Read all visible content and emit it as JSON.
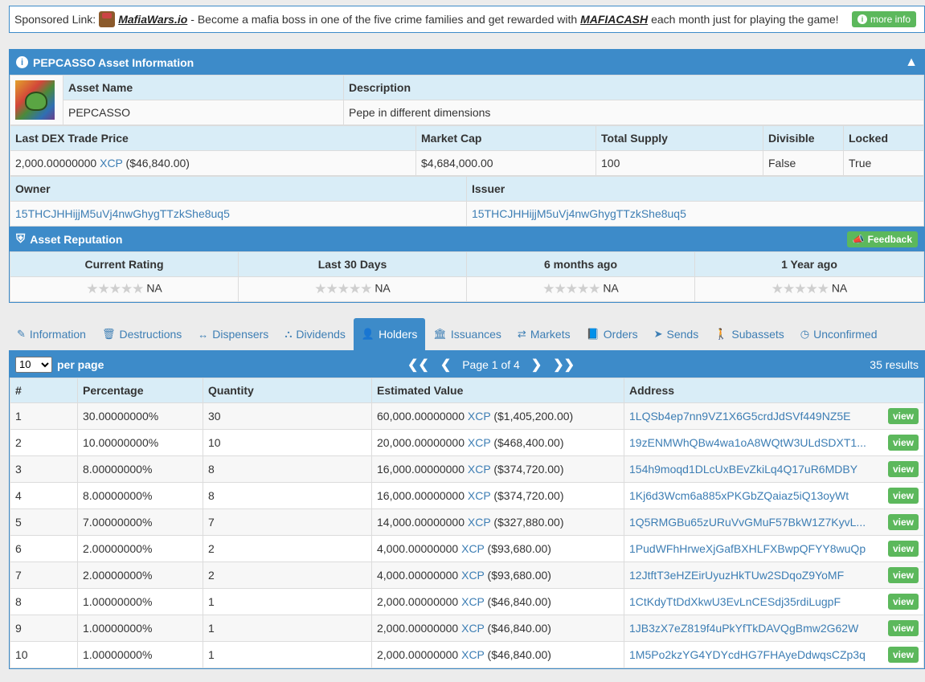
{
  "sponsor": {
    "prefix": "Sponsored Link:",
    "site": "MafiaWars.io",
    "text1": "- Become a mafia boss in one of the five crime families and get rewarded with",
    "cash": "MAFIACASH",
    "text2": "each month just for playing the game!",
    "more_info": "more info"
  },
  "asset_panel": {
    "title": "PEPCASSO Asset Information",
    "asset_name_label": "Asset Name",
    "description_label": "Description",
    "asset_name": "PEPCASSO",
    "description": "Pepe in different dimensions",
    "last_trade_label": "Last DEX Trade Price",
    "market_cap_label": "Market Cap",
    "total_supply_label": "Total Supply",
    "divisible_label": "Divisible",
    "locked_label": "Locked",
    "last_trade_amount": "2,000.00000000",
    "last_trade_unit": "XCP",
    "last_trade_usd": "($46,840.00)",
    "market_cap": "$4,684,000.00",
    "total_supply": "100",
    "divisible": "False",
    "locked": "True",
    "owner_label": "Owner",
    "issuer_label": "Issuer",
    "owner": "15THCJHHijjM5uVj4nwGhygTTzkShe8uq5",
    "issuer": "15THCJHHijjM5uVj4nwGhygTTzkShe8uq5"
  },
  "reputation": {
    "title": "Asset Reputation",
    "feedback": "Feedback",
    "columns": [
      "Current Rating",
      "Last 30 Days",
      "6 months ago",
      "1 Year ago"
    ],
    "values": [
      "NA",
      "NA",
      "NA",
      "NA"
    ]
  },
  "tabs": [
    {
      "label": "Information",
      "icon": "tag-icon",
      "glyph": "✎"
    },
    {
      "label": "Destructions",
      "icon": "trash-icon",
      "glyph": "🗑"
    },
    {
      "label": "Dispensers",
      "icon": "arrows-h-icon",
      "glyph": "↔"
    },
    {
      "label": "Dividends",
      "icon": "sitemap-icon",
      "glyph": "⛬"
    },
    {
      "label": "Holders",
      "icon": "user-icon",
      "glyph": "👤"
    },
    {
      "label": "Issuances",
      "icon": "bank-icon",
      "glyph": "🏛"
    },
    {
      "label": "Markets",
      "icon": "exchange-icon",
      "glyph": "⇄"
    },
    {
      "label": "Orders",
      "icon": "book-icon",
      "glyph": "📘"
    },
    {
      "label": "Sends",
      "icon": "send-icon",
      "glyph": "➤"
    },
    {
      "label": "Subassets",
      "icon": "child-icon",
      "glyph": "🚶"
    },
    {
      "label": "Unconfirmed",
      "icon": "clock-icon",
      "glyph": "◷"
    }
  ],
  "holders": {
    "per_page_value": "10",
    "per_page_label": "per page",
    "page_text": "Page 1 of 4",
    "results": "35 results",
    "columns": [
      "#",
      "Percentage",
      "Quantity",
      "Estimated Value",
      "Address"
    ],
    "view_label": "view",
    "rows": [
      {
        "n": "1",
        "pct": "30.00000000%",
        "qty": "30",
        "amt": "60,000.00000000",
        "unit": "XCP",
        "usd": "($1,405,200.00)",
        "addr": "1LQSb4ep7nn9VZ1X6G5crdJdSVf449NZ5E"
      },
      {
        "n": "2",
        "pct": "10.00000000%",
        "qty": "10",
        "amt": "20,000.00000000",
        "unit": "XCP",
        "usd": "($468,400.00)",
        "addr": "19zENMWhQBw4wa1oA8WQtW3ULdSDXT1..."
      },
      {
        "n": "3",
        "pct": "8.00000000%",
        "qty": "8",
        "amt": "16,000.00000000",
        "unit": "XCP",
        "usd": "($374,720.00)",
        "addr": "154h9moqd1DLcUxBEvZkiLq4Q17uR6MDBY"
      },
      {
        "n": "4",
        "pct": "8.00000000%",
        "qty": "8",
        "amt": "16,000.00000000",
        "unit": "XCP",
        "usd": "($374,720.00)",
        "addr": "1Kj6d3Wcm6a885xPKGbZQaiaz5iQ13oyWt"
      },
      {
        "n": "5",
        "pct": "7.00000000%",
        "qty": "7",
        "amt": "14,000.00000000",
        "unit": "XCP",
        "usd": "($327,880.00)",
        "addr": "1Q5RMGBu65zURuVvGMuF57BkW1Z7KyvL..."
      },
      {
        "n": "6",
        "pct": "2.00000000%",
        "qty": "2",
        "amt": "4,000.00000000",
        "unit": "XCP",
        "usd": "($93,680.00)",
        "addr": "1PudWFhHrweXjGafBXHLFXBwpQFYY8wuQp"
      },
      {
        "n": "7",
        "pct": "2.00000000%",
        "qty": "2",
        "amt": "4,000.00000000",
        "unit": "XCP",
        "usd": "($93,680.00)",
        "addr": "12JtftT3eHZEirUyuzHkTUw2SDqoZ9YoMF"
      },
      {
        "n": "8",
        "pct": "1.00000000%",
        "qty": "1",
        "amt": "2,000.00000000",
        "unit": "XCP",
        "usd": "($46,840.00)",
        "addr": "1CtKdyTtDdXkwU3EvLnCESdj35rdiLugpF"
      },
      {
        "n": "9",
        "pct": "1.00000000%",
        "qty": "1",
        "amt": "2,000.00000000",
        "unit": "XCP",
        "usd": "($46,840.00)",
        "addr": "1JB3zX7eZ819f4uPkYfTkDAVQgBmw2G62W"
      },
      {
        "n": "10",
        "pct": "1.00000000%",
        "qty": "1",
        "amt": "2,000.00000000",
        "unit": "XCP",
        "usd": "($46,840.00)",
        "addr": "1M5Po2kzYG4YDYcdHG7FHAyeDdwqsCZp3q"
      }
    ]
  },
  "colors": {
    "primary": "#3d8bc9",
    "header_cell": "#d9edf7",
    "link": "#3d7eb4",
    "button_green": "#5cb85c"
  }
}
